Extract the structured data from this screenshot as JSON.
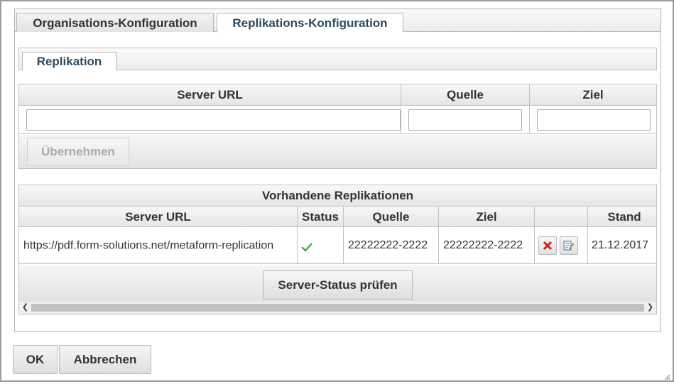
{
  "tabs": [
    {
      "label": "Organisations-Konfiguration",
      "active": false
    },
    {
      "label": "Replikations-Konfiguration",
      "active": true
    }
  ],
  "inner_tab": {
    "label": "Replikation"
  },
  "form": {
    "headers": {
      "server_url": "Server URL",
      "quelle": "Quelle",
      "ziel": "Ziel"
    },
    "server_url_value": "",
    "quelle_value": "",
    "ziel_value": "",
    "apply_label": "Übernehmen"
  },
  "grid": {
    "caption": "Vorhandene Replikationen",
    "headers": {
      "server_url": "Server URL",
      "status": "Status",
      "quelle": "Quelle",
      "ziel": "Ziel",
      "actions": "",
      "stand": "Stand"
    },
    "rows": [
      {
        "server_url": "https://pdf.form-solutions.net/metaform-replication",
        "status_icon": "checkmark-icon",
        "quelle": "22222222-2222",
        "ziel": "22222222-2222",
        "stand": "21.12.2017"
      }
    ],
    "check_status_label": "Server-Status prüfen"
  },
  "buttons": {
    "ok": "OK",
    "cancel": "Abbrechen"
  },
  "colors": {
    "tab_active_text": "#2e4a5f",
    "check_green": "#3aa62e",
    "delete_red": "#d02020",
    "edit_blue": "#2a6fb8"
  }
}
